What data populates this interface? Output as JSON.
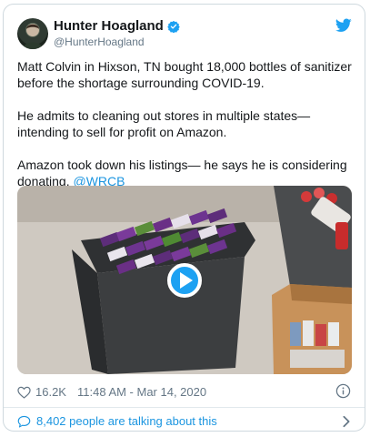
{
  "tweet": {
    "author_name": "Hunter Hoagland",
    "handle": "@HunterHoagland",
    "paragraph_1": "Matt Colvin in Hixson, TN bought 18,000  bottles of sanitizer before the shortage surrounding COVID-19.",
    "paragraph_2": "He admits to cleaning out stores in multiple states— intending to sell for profit on Amazon.",
    "paragraph_3_text": "Amazon took down his listings— he says he is considering donating. ",
    "mention": "@WRCB",
    "likes": "16.2K",
    "timestamp": "11:48 AM - Mar 14, 2020",
    "talking_text": "8,402 people are talking about this"
  },
  "colors": {
    "accent": "#1da1f2",
    "link": "#1b95e0",
    "text": "#14171a",
    "muted": "#657786",
    "border": "#cfd9de"
  },
  "icons": {
    "verified": "verified-badge-icon",
    "brand": "twitter-bird-icon",
    "play": "play-icon",
    "like": "heart-icon",
    "info": "info-icon",
    "replies": "speech-bubble-icon",
    "chevron": "chevron-right-icon"
  }
}
